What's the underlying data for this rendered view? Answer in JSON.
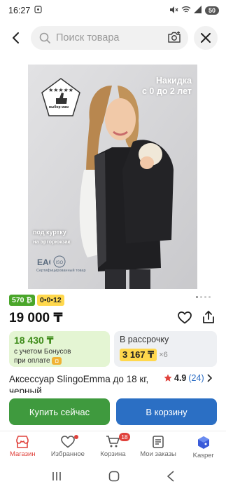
{
  "status_bar": {
    "time": "16:27",
    "battery": "50"
  },
  "search": {
    "placeholder": "Поиск товара"
  },
  "product": {
    "image_texts": {
      "badge": "выбор мам",
      "promo_top_line1": "Накидка",
      "promo_top_line2": "с 0 до 2 лет",
      "promo_bottom_line1": "под куртку",
      "promo_bottom_line2": "на эргорюкзак",
      "cert_mark": "EAC",
      "cert_text": "Сертифицированный товар"
    },
    "badges": {
      "bonus": "570 ₿",
      "installment": "0•0•12"
    },
    "price": "19 000 ₸",
    "bonus_price": "18 430 ₸",
    "bonus_note_line1": "с учетом Бонусов",
    "bonus_note_line2": "при оплате",
    "installment_label": "В рассрочку",
    "installment_monthly": "3 167 ₸",
    "installment_times": "×6",
    "title": "Аксессуар SlingoEmma до 18 кг, черный",
    "rating": "4.9",
    "reviews": "(24)"
  },
  "actions": {
    "buy_now": "Купить сейчас",
    "add_to_cart": "В корзину"
  },
  "nav": {
    "items": [
      {
        "label": "Магазин",
        "icon": "shop-icon"
      },
      {
        "label": "Избранное",
        "icon": "heart-icon"
      },
      {
        "label": "Корзина",
        "icon": "cart-icon",
        "badge": "18"
      },
      {
        "label": "Мои заказы",
        "icon": "orders-icon"
      },
      {
        "label": "Kasper",
        "icon": "kasper-icon"
      }
    ]
  },
  "colors": {
    "accent_red": "#e0423c",
    "buy_green": "#3f9a3e",
    "cart_blue": "#2b6fc4",
    "bonus_green": "#3d8b19",
    "highlight_yellow": "#ffd84d"
  }
}
